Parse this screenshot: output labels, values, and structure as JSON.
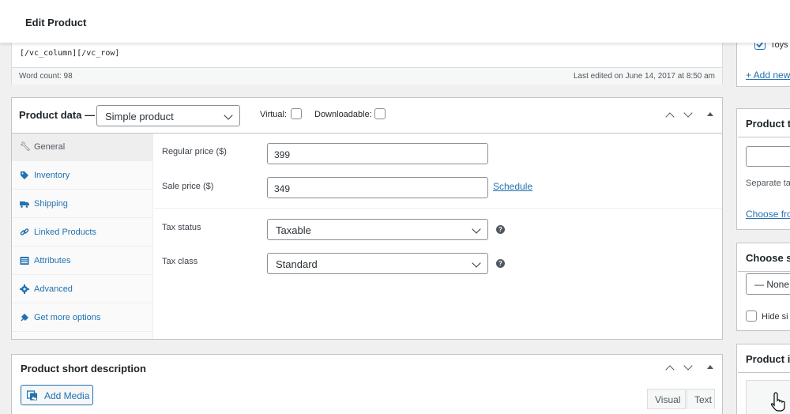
{
  "header": {
    "title": "Edit Product"
  },
  "editor": {
    "code_tail": "[/vc_column][/vc_row]",
    "word_count": "Word count: 98",
    "last_edited": "Last edited on June 14, 2017 at 8:50 am"
  },
  "product_data": {
    "label": "Product data —",
    "type_selected": "Simple product",
    "virtual_label": "Virtual:",
    "downloadable_label": "Downloadable:",
    "tabs": [
      {
        "label": "General",
        "icon": "wrench-icon"
      },
      {
        "label": "Inventory",
        "icon": "tag-icon"
      },
      {
        "label": "Shipping",
        "icon": "truck-icon"
      },
      {
        "label": "Linked Products",
        "icon": "link-icon"
      },
      {
        "label": "Attributes",
        "icon": "list-icon"
      },
      {
        "label": "Advanced",
        "icon": "gear-icon"
      },
      {
        "label": "Get more options",
        "icon": "plugin-icon"
      }
    ],
    "regular_price_label": "Regular price ($)",
    "regular_price_value": "399",
    "sale_price_label": "Sale price ($)",
    "sale_price_value": "349",
    "schedule_link": "Schedule",
    "tax_status_label": "Tax status",
    "tax_status_value": "Taxable",
    "tax_class_label": "Tax class",
    "tax_class_value": "Standard"
  },
  "short_description": {
    "title": "Product short description",
    "add_media": "Add Media",
    "tab_visual": "Visual",
    "tab_text": "Text"
  },
  "sidebar": {
    "category_item": "Toys",
    "add_new_link": "+ Add new",
    "tags_title": "Product ta",
    "tags_hint": "Separate ta",
    "tags_choose": "Choose fro",
    "size_title": "Choose si",
    "size_value": "— None",
    "hide_label": "Hide si",
    "image_title": "Product i"
  },
  "colors": {
    "link": "#2271b1",
    "border": "#c3c4c7",
    "background": "#f0f0f1"
  }
}
